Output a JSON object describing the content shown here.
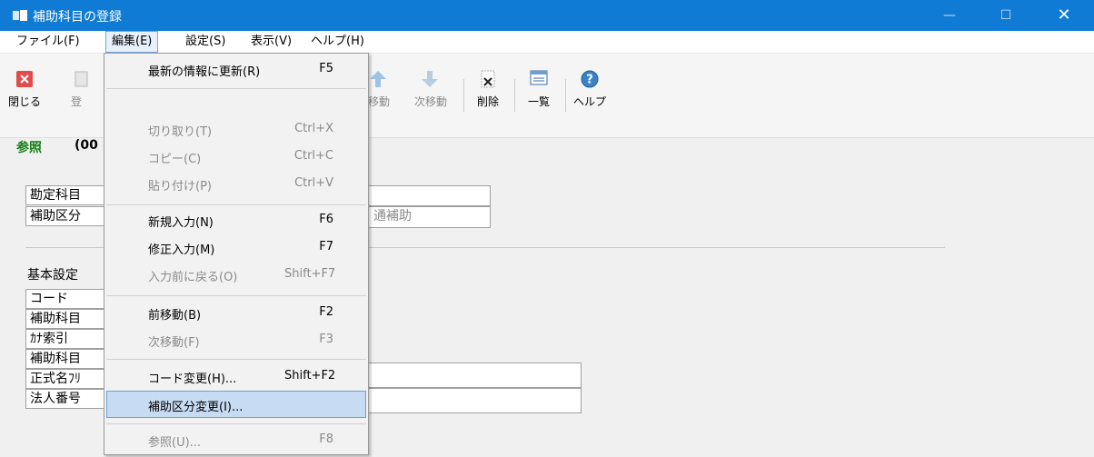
{
  "window": {
    "title": "補助科目の登録",
    "controls": [
      "—",
      "☐",
      "✕"
    ]
  },
  "menubar": [
    {
      "label": "ファイル(F)",
      "active": false
    },
    {
      "label": "編集(E)",
      "active": true
    },
    {
      "label": "設定(S)",
      "active": false
    },
    {
      "label": "表示(V)",
      "active": false
    },
    {
      "label": "ヘルプ(H)",
      "active": false
    }
  ],
  "toolbar": {
    "close": "閉じる",
    "register": "登",
    "prev_move": "移動",
    "next_move": "次移動",
    "delete": "削除",
    "list": "一覧",
    "help": "ヘルプ"
  },
  "tab": {
    "label": "参照",
    "code": "(00"
  },
  "form": {
    "account_label": "勘定科目",
    "subclass_label": "補助区分",
    "subclass_value": "通補助",
    "basic_settings": "基本設定",
    "rows": [
      "コード",
      "補助科目",
      "ｶﾅ索引",
      "補助科目",
      "正式名ﾌﾘ",
      "法人番号"
    ]
  },
  "edit_menu": {
    "items": [
      {
        "label": "最新の情報に更新(R)",
        "key": "F5",
        "disabled": false
      },
      {
        "label": "切り取り(T)",
        "key": "Ctrl+X",
        "disabled": true
      },
      {
        "label": "コピー(C)",
        "key": "Ctrl+C",
        "disabled": true
      },
      {
        "label": "貼り付け(P)",
        "key": "Ctrl+V",
        "disabled": true
      },
      {
        "label": "新規入力(N)",
        "key": "F6",
        "disabled": false
      },
      {
        "label": "修正入力(M)",
        "key": "F7",
        "disabled": false
      },
      {
        "label": "入力前に戻る(O)",
        "key": "Shift+F7",
        "disabled": true
      },
      {
        "label": "前移動(B)",
        "key": "F2",
        "disabled": false
      },
      {
        "label": "次移動(F)",
        "key": "F3",
        "disabled": true
      },
      {
        "label": "コード変更(H)...",
        "key": "Shift+F2",
        "disabled": false
      },
      {
        "label": "補助区分変更(I)...",
        "key": "",
        "disabled": false,
        "highlighted": true
      },
      {
        "label": "参照(U)...",
        "key": "F8",
        "disabled": true
      }
    ]
  },
  "colors": {
    "titlebar": "#0f7bd4",
    "highlight": "#c7dcf2",
    "tab_green": "#1a7f1a"
  }
}
